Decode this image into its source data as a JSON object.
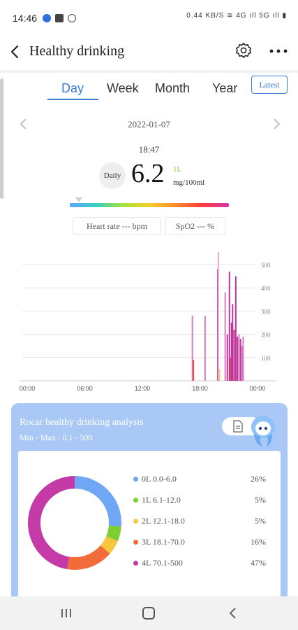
{
  "status_bar": {
    "time": "14:46",
    "indicators": "0.44 KB/S  ≋ 4G ıll 5G ıll ▮"
  },
  "header": {
    "title": "Healthy drinking",
    "back_icon": "chevron-left-icon",
    "settings_icon": "gear-icon",
    "more_icon": "more-dots-icon"
  },
  "tabs": [
    {
      "label": "Day",
      "active": true
    },
    {
      "label": "Week",
      "active": false
    },
    {
      "label": "Month",
      "active": false
    },
    {
      "label": "Year",
      "active": false
    }
  ],
  "latest_button": "Latest",
  "date": "2022-01-07",
  "reading": {
    "time": "18:47",
    "badge": "Daily",
    "value": "6.2",
    "level": "1L",
    "unit": "mg/100ml"
  },
  "metrics": {
    "heart_rate": "Heart rate --- bpm",
    "spo2": "SpO2 --- %"
  },
  "chart_data": {
    "type": "bar",
    "x_tick_labels": [
      "00:00",
      "06:00",
      "12:00",
      "18:00",
      "00:00"
    ],
    "y_tick_labels": [
      "500",
      "400",
      "300",
      "200",
      "100"
    ],
    "ylim": [
      0,
      500
    ],
    "x_unit": "hour",
    "xlim": [
      0,
      24
    ],
    "grid": true,
    "series": [
      {
        "bars": [
          {
            "x": 16.0,
            "value": 280,
            "color": "#d57cc2"
          },
          {
            "x": 16.1,
            "value": 90,
            "color": "#e0564a"
          },
          {
            "x": 17.2,
            "value": 280,
            "color": "#d57cc2"
          },
          {
            "x": 18.4,
            "value": 480,
            "color": "#c0359a"
          },
          {
            "x": 18.55,
            "value": 50,
            "color": "#f5c94a"
          },
          {
            "x": 19.1,
            "value": 380,
            "color": "#d57cc2"
          },
          {
            "x": 19.3,
            "value": 200,
            "color": "#c0359a"
          },
          {
            "x": 19.5,
            "value": 470,
            "color": "#c0359a"
          },
          {
            "x": 19.6,
            "value": 100,
            "color": "#e0564a"
          },
          {
            "x": 19.7,
            "value": 250,
            "color": "#c0359a"
          },
          {
            "x": 19.8,
            "value": 330,
            "color": "#c0359a"
          },
          {
            "x": 19.95,
            "value": 220,
            "color": "#c0359a"
          },
          {
            "x": 20.1,
            "value": 450,
            "color": "#c0359a"
          },
          {
            "x": 20.25,
            "value": 190,
            "color": "#c0359a"
          },
          {
            "x": 20.4,
            "value": 200,
            "color": "#d57cc2"
          },
          {
            "x": 20.55,
            "value": 180,
            "color": "#c0359a"
          },
          {
            "x": 20.7,
            "value": 150,
            "color": "#d57cc2"
          },
          {
            "x": 20.8,
            "value": 190,
            "color": "#d57cc2"
          },
          {
            "x": 18.45,
            "value": 570,
            "color": "#e7a6da"
          }
        ]
      }
    ]
  },
  "analysis": {
    "title": "Rocar healthy drinking analysis",
    "range_label": "Min - Max :  0.1 - 500",
    "report_icon": "document-icon",
    "mascot_icon": "mascot-icon",
    "legend": [
      {
        "label": "0L 0.0-6.0",
        "percent": "26%",
        "value": 26,
        "color": "#6fa7f5"
      },
      {
        "label": "1L 6.1-12.0",
        "percent": "5%",
        "value": 5,
        "color": "#7ccf2e"
      },
      {
        "label": "2L 12.1-18.0",
        "percent": "5%",
        "value": 5,
        "color": "#f5c73d"
      },
      {
        "label": "3L 18.1-70.0",
        "percent": "16%",
        "value": 16,
        "color": "#f26b3a"
      },
      {
        "label": "4L 70.1-500",
        "percent": "47%",
        "value": 47,
        "color": "#c43aa6"
      }
    ]
  },
  "nav": {
    "recents_icon": "recents-icon",
    "home_icon": "home-icon",
    "back_icon": "back-icon"
  }
}
